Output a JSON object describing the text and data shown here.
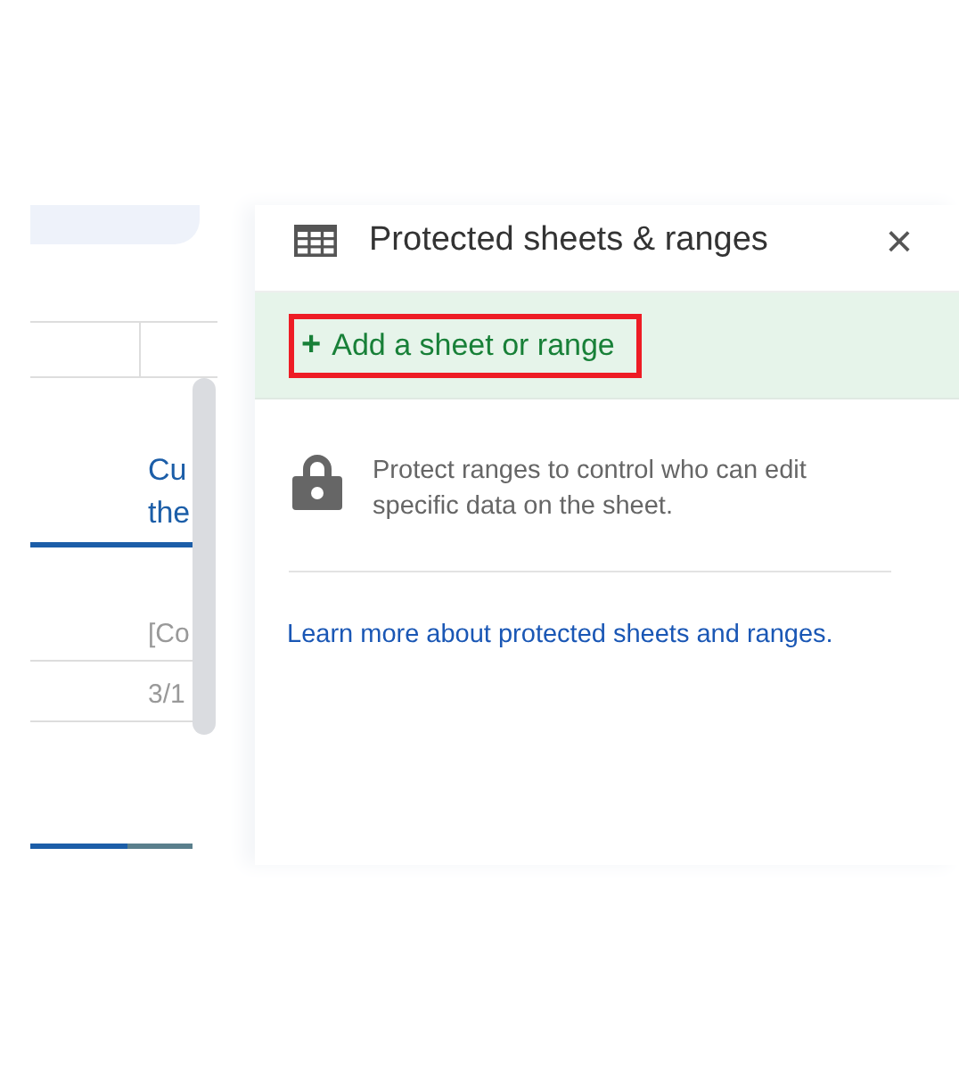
{
  "sheet": {
    "header_texts": [
      "Cu",
      "the"
    ],
    "cells": [
      "[Co",
      "3/1"
    ]
  },
  "panel": {
    "title": "Protected sheets & ranges",
    "close": "×",
    "add_button": {
      "label": "Add a sheet or range",
      "icon": "+",
      "highlighted": true
    },
    "description": "Protect ranges to control who can edit specific data on the sheet.",
    "link": "Learn more about protected sheets and ranges."
  }
}
